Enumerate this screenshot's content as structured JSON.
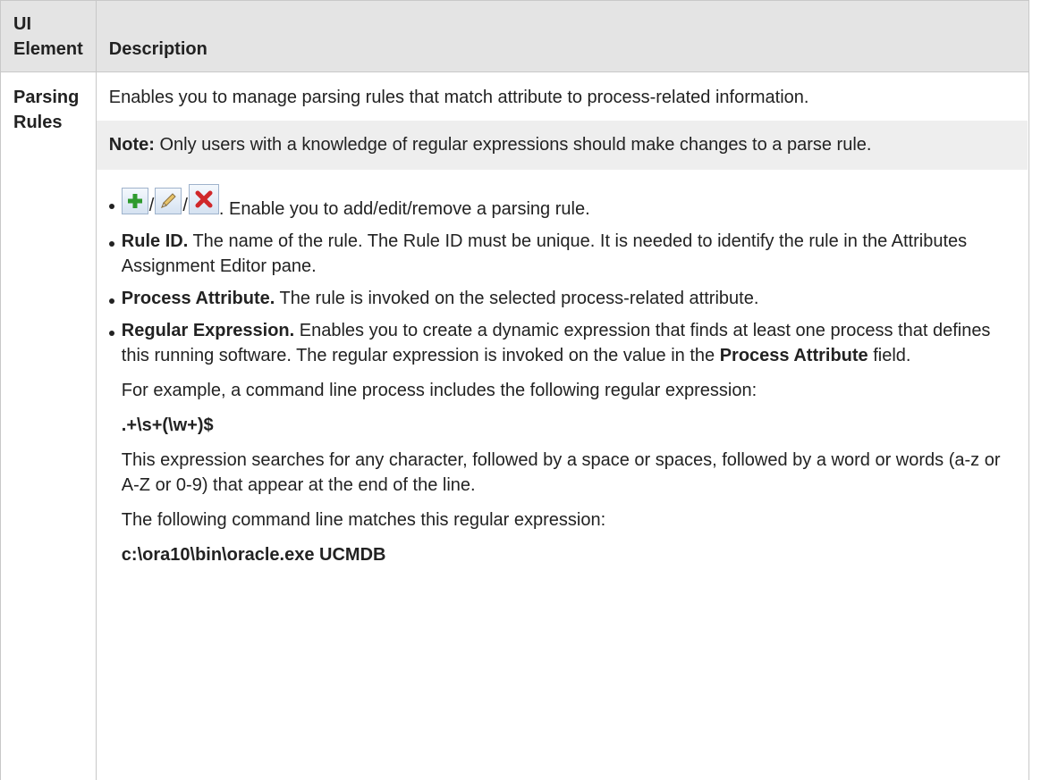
{
  "table": {
    "headers": {
      "ui_element": "UI Element",
      "description": "Description"
    },
    "row": {
      "ui_element": "Parsing Rules",
      "intro": "Enables you to manage parsing rules that match attribute to process-related information.",
      "note": {
        "label": "Note:",
        "text": " Only users with a knowledge of regular expressions should make changes to a parse rule."
      },
      "icons_item": {
        "separator": "/",
        "text": ". Enable you to add/edit/remove a parsing rule.",
        "icons": [
          "add-icon",
          "edit-icon",
          "remove-icon"
        ]
      },
      "rule_id": {
        "label": "Rule ID.",
        "text": " The name of the rule. The Rule ID must be unique. It is needed to identify the rule in the Attributes Assignment Editor pane."
      },
      "process_attribute": {
        "label": "Process Attribute.",
        "text": " The rule is invoked on the selected process-related attribute."
      },
      "regular_expression": {
        "label": "Regular Expression.",
        "text_a": " Enables you to create a dynamic expression that finds at least one process that defines this running software. The regular expression is invoked on the value in the ",
        "field_name": "Process Attribute",
        "text_b": " field.",
        "example_intro": "For example, a command line process includes the following regular expression:",
        "example_regex": ".+\\s+(\\w+)$",
        "explanation": "This expression searches for any character, followed by a space or spaces, followed by a word or words (a-z or A-Z or 0-9) that appear at the end of the line.",
        "match_intro": "The following command line matches this regular expression:",
        "match_example": "c:\\ora10\\bin\\oracle.exe UCMDB"
      }
    }
  },
  "colors": {
    "header_bg": "#e4e4e4",
    "note_bg": "#eeeeee",
    "border": "#c8c8c8",
    "add_icon": "#2e9a2e",
    "remove_icon": "#d0282a"
  }
}
